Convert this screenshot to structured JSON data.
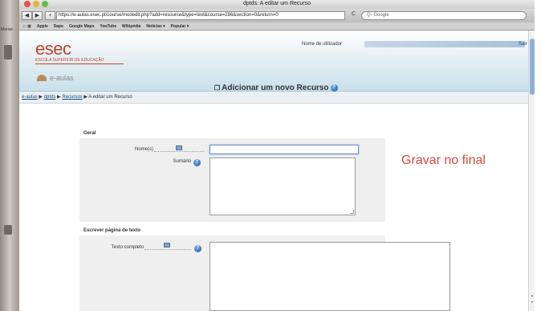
{
  "window": {
    "title": "dptds: A editar um Recurso",
    "desktop_label": "Marise"
  },
  "toolbar": {
    "back": "◀",
    "forward": "▶",
    "add": "+",
    "url": "https://e-aulas.esec.pt/course/modedit.php?add=resource&type=text&course=286&section=0&return=0",
    "reload": "C",
    "search_placeholder": "Q- Google"
  },
  "bookmarks": [
    "Apple",
    "Sapo",
    "Google Maps",
    "YouTube",
    "Wikipédia",
    "Notícias ▾",
    "Popular ▾"
  ],
  "header": {
    "logo": "esec",
    "logo_sub": "ESCOLA SUPERIOR DE EDUCAÇÃO",
    "eaulas": "e-aulas",
    "user_label": "Nome de utilizador:",
    "logout": "Sair"
  },
  "breadcrumb": {
    "items": [
      "e-aulas",
      "dptds",
      "Recursos"
    ],
    "sep": "▶",
    "current": "A editar um Recurso"
  },
  "form": {
    "title": "Adicionar um novo Recurso",
    "geral": "Geral",
    "name_label": "Nome(s)",
    "summary_label": "Sumário",
    "write_page": "Escrever página de texto",
    "full_text_label": "Texto completo"
  },
  "annotation": "Gravar no final",
  "colors": {
    "brand": "#c2422b",
    "link": "#114a82",
    "annotation": "#d64a3a"
  }
}
